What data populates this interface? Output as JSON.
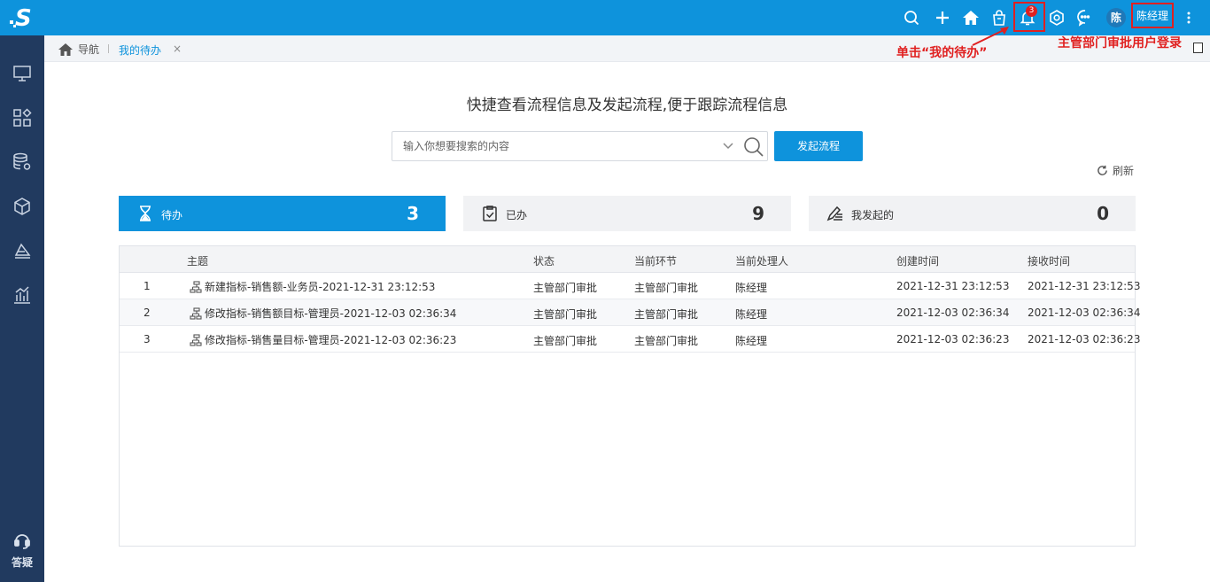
{
  "logo": {
    "name": "s-logo-icon"
  },
  "sidebar": {
    "items": [
      {
        "name": "monitor-icon"
      },
      {
        "name": "apps-icon"
      },
      {
        "name": "database-settings-icon"
      },
      {
        "name": "cube-icon"
      },
      {
        "name": "layers-icon"
      },
      {
        "name": "chart-icon"
      }
    ],
    "help_label": "答疑"
  },
  "topbar": {
    "notification_count": "3",
    "avatar_text": "陈",
    "username": "陈经理"
  },
  "tabs": {
    "home_label": "导航",
    "active_tab": "我的待办",
    "close_glyph": "×"
  },
  "annotations": {
    "click_hint": "单击“我的待办”",
    "login_hint": "主管部门审批用户登录"
  },
  "main": {
    "headline": "快捷查看流程信息及发起流程,便于跟踪流程信息",
    "search_placeholder": "输入你想要搜索的内容",
    "start_button": "发起流程",
    "refresh_label": "刷新"
  },
  "cards": [
    {
      "label": "待办",
      "count": "3",
      "icon": "hourglass-icon"
    },
    {
      "label": "已办",
      "count": "9",
      "icon": "clipboard-check-icon"
    },
    {
      "label": "我发起的",
      "count": "0",
      "icon": "pen-list-icon"
    }
  ],
  "table": {
    "headers": [
      "主题",
      "状态",
      "当前环节",
      "当前处理人",
      "创建时间",
      "接收时间"
    ],
    "rows": [
      {
        "index": "1",
        "subject": "新建指标-销售额-业务员-2021-12-31 23:12:53",
        "status": "主管部门审批",
        "stage": "主管部门审批",
        "handler": "陈经理",
        "created": "2021-12-31 23:12:53",
        "received": "2021-12-31 23:12:53"
      },
      {
        "index": "2",
        "subject": "修改指标-销售额目标-管理员-2021-12-03 02:36:34",
        "status": "主管部门审批",
        "stage": "主管部门审批",
        "handler": "陈经理",
        "created": "2021-12-03 02:36:34",
        "received": "2021-12-03 02:36:34"
      },
      {
        "index": "3",
        "subject": "修改指标-销售量目标-管理员-2021-12-03 02:36:23",
        "status": "主管部门审批",
        "stage": "主管部门审批",
        "handler": "陈经理",
        "created": "2021-12-03 02:36:23",
        "received": "2021-12-03 02:36:23"
      }
    ]
  },
  "colors": {
    "brand": "#0e93dc",
    "sidebar": "#213a5f",
    "annotation": "#e02020"
  }
}
